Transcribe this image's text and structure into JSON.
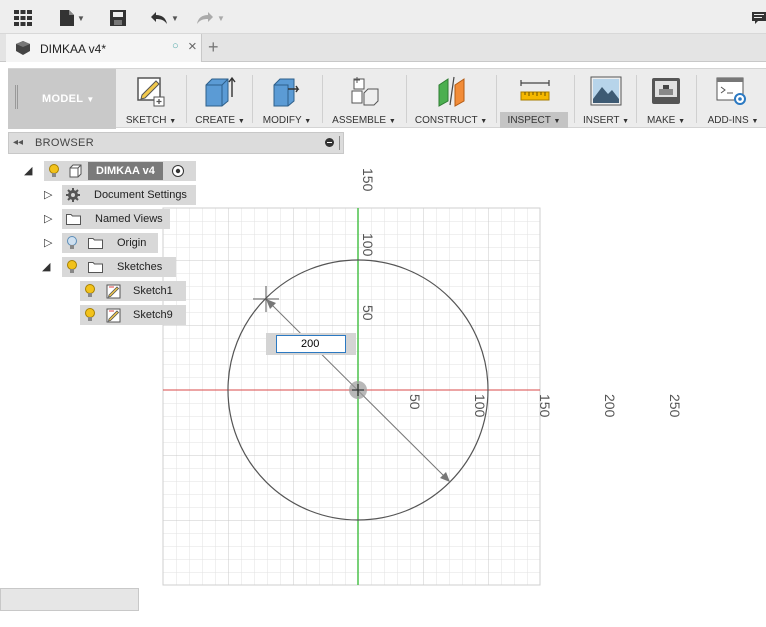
{
  "quick_access": {
    "icons": [
      "grid-icon",
      "file-icon",
      "save-icon",
      "undo-icon",
      "redo-icon",
      "comment-icon"
    ]
  },
  "document_tab": {
    "title": "DIMKAA v4*"
  },
  "toolbar": {
    "workspace": "MODEL",
    "groups": [
      {
        "label": "SKETCH",
        "icon": "sketch-icon"
      },
      {
        "label": "CREATE",
        "icon": "create-box-icon"
      },
      {
        "label": "MODIFY",
        "icon": "modify-icon"
      },
      {
        "label": "ASSEMBLE",
        "icon": "assemble-icon"
      },
      {
        "label": "CONSTRUCT",
        "icon": "construct-plane-icon"
      },
      {
        "label": "INSPECT",
        "icon": "inspect-ruler-icon"
      },
      {
        "label": "INSERT",
        "icon": "insert-image-icon"
      },
      {
        "label": "MAKE",
        "icon": "make-printer-icon"
      },
      {
        "label": "ADD-INS",
        "icon": "add-ins-script-icon"
      }
    ],
    "active_group": "INSPECT"
  },
  "browser": {
    "header": "BROWSER",
    "root": "DIMKAA v4",
    "items": [
      {
        "label": "Document Settings",
        "icon": "gear-icon"
      },
      {
        "label": "Named Views",
        "icon": "folder-icon"
      },
      {
        "label": "Origin",
        "icon": "folder-icon"
      },
      {
        "label": "Sketches",
        "icon": "folder-icon"
      }
    ],
    "sketches": [
      "Sketch1",
      "Sketch9"
    ]
  },
  "viewport": {
    "ruler_labels": {
      "vertical": [
        "150",
        "100",
        "50"
      ],
      "horizontal": [
        "50",
        "100",
        "150",
        "200",
        "250"
      ]
    },
    "dimension_value": "200",
    "colors": {
      "x_axis": "#d94a4a",
      "y_axis": "#4cc24c",
      "grid": "#d8d8d8",
      "sketch": "#555555"
    }
  }
}
